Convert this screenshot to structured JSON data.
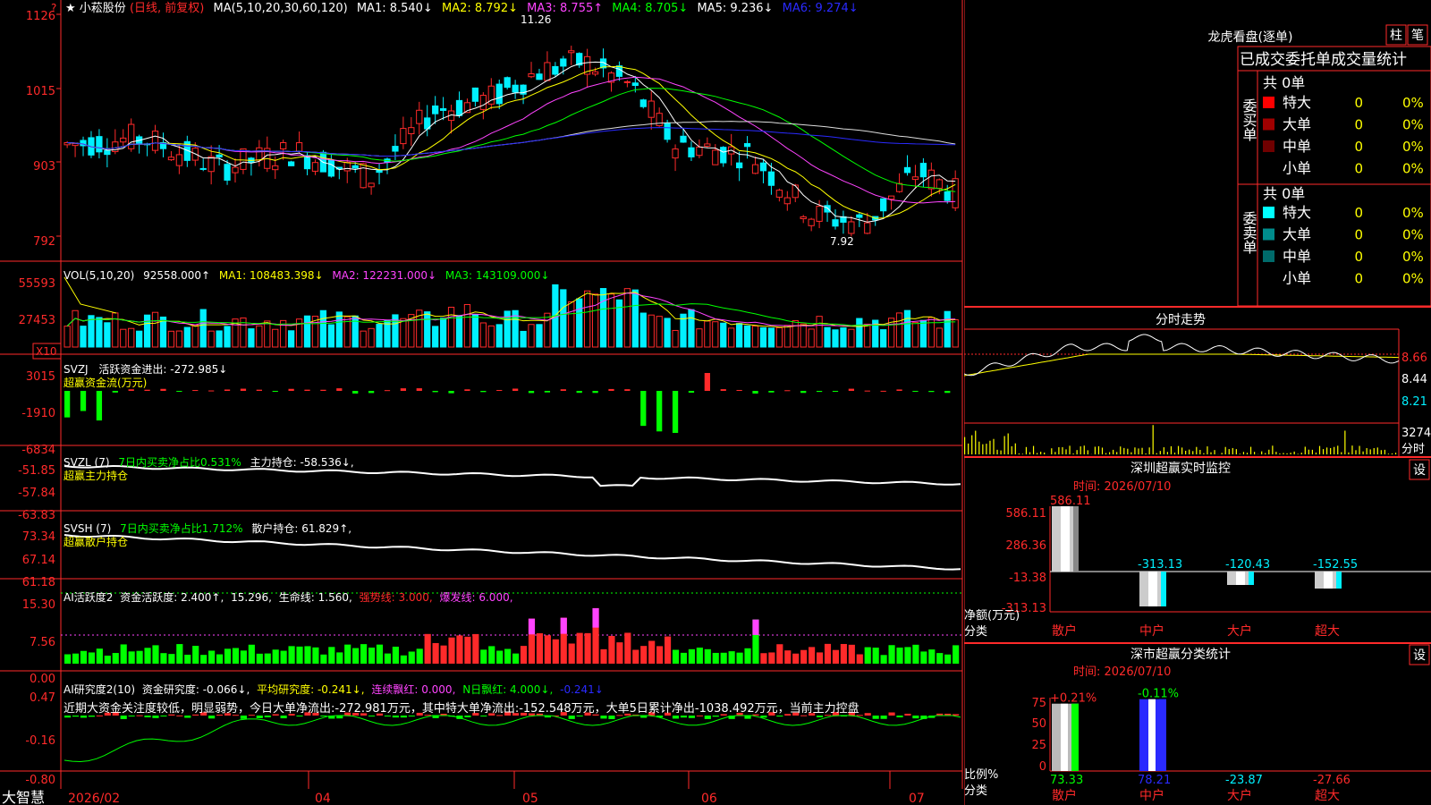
{
  "colors": {
    "up": "#ff2a2a",
    "down": "#00f0ff",
    "axis": "#ff2a2a",
    "grid": "#a00000",
    "white": "#ffffff",
    "yellow": "#ffff00",
    "magenta": "#ff44ff",
    "green": "#00ff00",
    "blue": "#2a2aff",
    "cyan": "#00f0ff"
  },
  "main": {
    "title_star": "★",
    "stock_name": "小菘股份",
    "mode": "(日线, 前复权)",
    "ma_params": "MA(5,10,20,30,60,120)",
    "ma1": "MA1: 8.540↓",
    "ma2": "MA2: 8.792↓",
    "ma3": "MA3: 8.755↑",
    "ma4": "MA4: 8.705↓",
    "ma5": "MA5: 9.236↓",
    "ma6": "MA6: 9.274↓",
    "y_ticks": [
      "1126",
      "1015",
      "903",
      "792"
    ],
    "y_values": [
      11.26,
      10.15,
      9.03,
      7.92
    ],
    "high_label": "11.26",
    "low_label": "7.92",
    "marker": "?"
  },
  "vol": {
    "title": "VOL(5,10,20)",
    "value": "92558.000↑",
    "ma1": "MA1: 108483.398↓",
    "ma2": "MA2: 122231.000↓",
    "ma3": "MA3: 143109.000↓",
    "y_ticks": [
      "55593",
      "27453"
    ],
    "unit": "X10"
  },
  "svzj": {
    "title": "SVZJ",
    "label": "活跃资金进出: -272.985↓",
    "subtitle": "超赢资金流(万元)",
    "y_ticks": [
      "3015",
      "-1910",
      "-6834"
    ]
  },
  "svzl": {
    "title": "SVZL (7)",
    "label1": "7日内买卖净占比0.531%",
    "label2": "主力持仓: -58.536↓,",
    "subtitle": "超赢主力持仓",
    "y_ticks": [
      "-51.85",
      "-57.84",
      "-63.83"
    ]
  },
  "svsh": {
    "title": "SVSH (7)",
    "label1": "7日内买卖净占比1.712%",
    "label2": "散户持仓: 61.829↑,",
    "subtitle": "超赢散户持仓",
    "y_ticks": [
      "73.34",
      "67.14",
      "61.18"
    ]
  },
  "ai1": {
    "title": "AI活跃度2",
    "label1": "资金活跃度: 2.400↑,",
    "label2": "15.296,",
    "label3": "生命线: 1.560,",
    "label4": "强势线: 3.000,",
    "label5": "爆发线: 6.000,",
    "y_ticks": [
      "15.30",
      "7.56",
      "0.00"
    ]
  },
  "ai2": {
    "title": "AI研究度2(10)",
    "label1": "资金研究度: -0.066↓,",
    "label2": "平均研究度: -0.241↓,",
    "label3": "连续飘红: 0.000,",
    "label4": "N日飘红: 4.000↓,",
    "label5": "-0.241↓",
    "comment": "近期大资金关注度较低，明显弱势，今日大单净流出:-272.981万元，其中特大单净流出:-152.548万元，大单5日累计净出-1038.492万元，当前主力控盘",
    "y_ticks": [
      "0.47",
      "-0.16",
      "-0.80"
    ]
  },
  "xaxis": {
    "labels": [
      "2026/02",
      "04",
      "05",
      "06",
      "07"
    ],
    "bottom_left": "大智慧"
  },
  "right": {
    "dragon_title": "龙虎看盘(逐单)",
    "btn_zhu": "柱",
    "btn_bi": "笔",
    "stats_title": "已成交委托单成交量统计",
    "buy_group": "委买单",
    "sell_group": "委卖单",
    "buy_total": "共 0单",
    "sell_total": "共 0单",
    "buy_rows": [
      {
        "label": "特大",
        "count": "0",
        "pct": "0%",
        "color": "#ff0000"
      },
      {
        "label": "大单",
        "count": "0",
        "pct": "0%",
        "color": "#a00000"
      },
      {
        "label": "中单",
        "count": "0",
        "pct": "0%",
        "color": "#700000"
      },
      {
        "label": "小单",
        "count": "0",
        "pct": "0%",
        "color": "#000000"
      }
    ],
    "sell_rows": [
      {
        "label": "特大",
        "count": "0",
        "pct": "0%",
        "color": "#00ffff"
      },
      {
        "label": "大单",
        "count": "0",
        "pct": "0%",
        "color": "#008c8c"
      },
      {
        "label": "中单",
        "count": "0",
        "pct": "0%",
        "color": "#006b6b"
      },
      {
        "label": "小单",
        "count": "0",
        "pct": "0%",
        "color": "#000000"
      }
    ],
    "intraday_title": "分时走势",
    "intraday_ticks": [
      "8.66",
      "8.44",
      "8.21"
    ],
    "intraday_vol": "3274",
    "intraday_vol_unit": "分时",
    "sz_title": "深圳超赢实时监控",
    "sz_btn": "设",
    "sz_time": "时间: 2026/07/10",
    "sz_ticks": [
      "586.11",
      "286.36",
      "-13.38",
      "-313.13"
    ],
    "sz_unit": "净额(万元)",
    "sz_cat_label": "分类",
    "sz_cats": [
      "散户",
      "中户",
      "大户",
      "超大"
    ],
    "sz_values": [
      "586.11",
      "-313.13",
      "-120.43",
      "-152.55"
    ],
    "sc_title": "深市超赢分类统计",
    "sc_btn": "设",
    "sc_time": "时间: 2026/07/10",
    "sc_ticks": [
      "75",
      "50",
      "25",
      "0"
    ],
    "sc_unit": "比例%",
    "sc_cat_label": "分类",
    "sc_top": [
      "+0.21%",
      "-0.11%"
    ],
    "sc_values": [
      "73.33",
      "78.21",
      "-23.87",
      "-27.66"
    ],
    "sc_cats": [
      "散户",
      "中户",
      "大户",
      "超大"
    ]
  }
}
